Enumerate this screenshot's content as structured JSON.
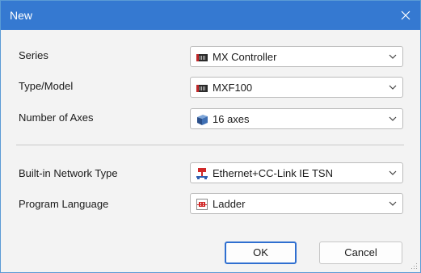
{
  "window": {
    "title": "New",
    "accent_color": "#3579d1"
  },
  "fields": [
    {
      "label": "Series",
      "value": "MX Controller",
      "icon": "controller-module-icon"
    },
    {
      "label": "Type/Model",
      "value": "MXF100",
      "icon": "controller-module-icon"
    },
    {
      "label": "Number of Axes",
      "value": "16 axes",
      "icon": "axes-cube-icon"
    },
    {
      "label": "Built-in Network Type",
      "value": "Ethernet+CC-Link IE TSN",
      "icon": "network-icon"
    },
    {
      "label": "Program Language",
      "value": "Ladder",
      "icon": "ladder-icon"
    }
  ],
  "buttons": {
    "ok": "OK",
    "cancel": "Cancel"
  }
}
